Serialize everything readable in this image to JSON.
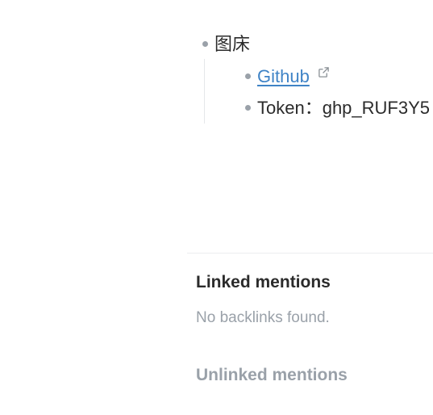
{
  "outline": {
    "parent": {
      "label": "图床"
    },
    "children": [
      {
        "link_label": "Github"
      },
      {
        "label": "Token：ghp_RUF3Y5"
      }
    ]
  },
  "references": {
    "linked_title": "Linked mentions",
    "linked_empty": "No backlinks found.",
    "unlinked_title": "Unlinked mentions"
  },
  "colors": {
    "link": "#3f83c6",
    "bullet": "#9aa1a9",
    "muted_text": "#9aa1a9",
    "text": "#2b2b2b"
  },
  "icons": {
    "external_link": "external-link-icon",
    "bullet": "bullet-dot"
  }
}
